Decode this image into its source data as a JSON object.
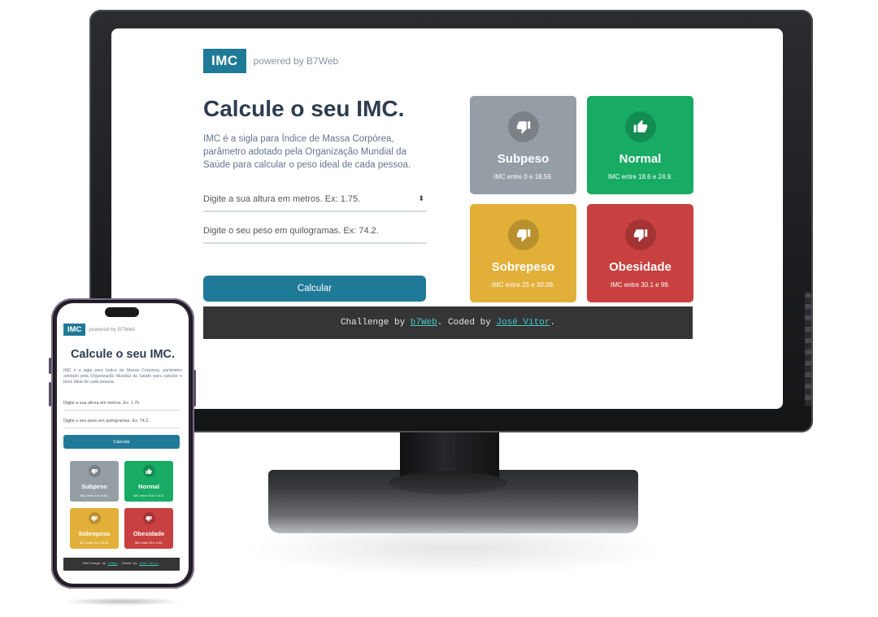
{
  "brand": {
    "logo": "IMC",
    "powered": "powered by B7Web"
  },
  "main": {
    "title": "Calcule o seu IMC.",
    "description": "IMC é a sigla para Índice de Massa Corpórea, parâmetro adotado pela Organização Mundial da Saúde para calcular o peso ideal de cada pessoa.",
    "height_placeholder": "Digite a sua altura em metros. Ex: 1.75.",
    "weight_placeholder": "Digite o seu peso em quilogramas. Ex: 74.2.",
    "calculate_label": "Calcular"
  },
  "categories": [
    {
      "name": "Subpeso",
      "range": "IMC entre 0 e 18.59.",
      "color": "#959ea5",
      "icon": "thumbs-down-icon"
    },
    {
      "name": "Normal",
      "range": "IMC entre 18.6 e 24.9.",
      "color": "#18ab64",
      "icon": "thumbs-up-icon"
    },
    {
      "name": "Sobrepeso",
      "range": "IMC entre 25 e 30.09.",
      "color": "#e2b039",
      "icon": "thumbs-down-icon"
    },
    {
      "name": "Obesidade",
      "range": "IMC entre 30.1 e 99.",
      "color": "#c8403f",
      "icon": "thumbs-down-icon"
    }
  ],
  "footer": {
    "prefix": "Challenge by",
    "b7web": "b7Web",
    "middle": ". Coded by",
    "author": "José Vitor",
    "suffix": "."
  },
  "colors": {
    "accent": "#1f7a97",
    "title": "#2d3d4f",
    "footer_bg": "#353535",
    "footer_link": "#47c9c9"
  }
}
